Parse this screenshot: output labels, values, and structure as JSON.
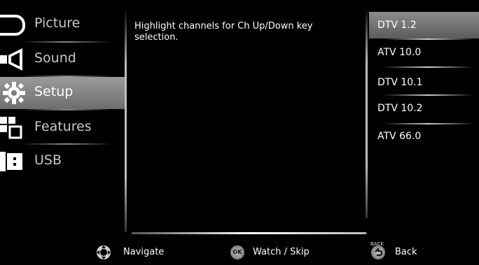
{
  "sidebar": {
    "items": [
      {
        "label": "Picture",
        "icon": "picture-icon"
      },
      {
        "label": "Sound",
        "icon": "speaker-icon"
      },
      {
        "label": "Setup",
        "icon": "gear-icon",
        "active": true
      },
      {
        "label": "Features",
        "icon": "features-icon"
      },
      {
        "label": "USB",
        "icon": "usb-icon"
      }
    ]
  },
  "description": "Highlight channels for Ch Up/Down key selection.",
  "channels": [
    {
      "label": "DTV 1.2",
      "active": true
    },
    {
      "label": "ATV 10.0"
    },
    {
      "label": "DTV 10.1"
    },
    {
      "label": "DTV 10.2"
    },
    {
      "label": "ATV 66.0"
    }
  ],
  "footer": {
    "navigate_label": "Navigate",
    "ok_icon_text": "OK",
    "watch_label": "Watch / Skip",
    "back_small": "BACK",
    "back_label": "Back"
  },
  "colors": {
    "background": "#000000",
    "active_highlight": "#8a8a8a"
  }
}
